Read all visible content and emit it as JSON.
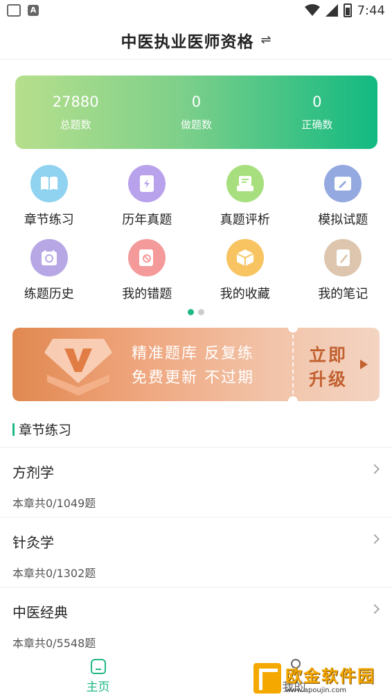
{
  "status_bar": {
    "time": "7:44"
  },
  "header": {
    "title": "中医执业医师资格",
    "switch_icon": "⇌"
  },
  "stats": [
    {
      "value": "27880",
      "label": "总题数"
    },
    {
      "value": "0",
      "label": "做题数"
    },
    {
      "value": "0",
      "label": "正确数"
    }
  ],
  "features": [
    {
      "label": "章节练习",
      "icon": "book-icon",
      "color": "#8fd3f0"
    },
    {
      "label": "历年真题",
      "icon": "document-icon",
      "color": "#b9a2ec"
    },
    {
      "label": "真题评析",
      "icon": "review-icon",
      "color": "#a8df7e"
    },
    {
      "label": "模拟试题",
      "icon": "exam-icon",
      "color": "#93a9df"
    },
    {
      "label": "练题历史",
      "icon": "history-icon",
      "color": "#b7a7e5"
    },
    {
      "label": "我的错题",
      "icon": "wrong-icon",
      "color": "#f49a9a"
    },
    {
      "label": "我的收藏",
      "icon": "box-icon",
      "color": "#f7c461"
    },
    {
      "label": "我的笔记",
      "icon": "note-icon",
      "color": "#ddc6ad"
    }
  ],
  "banner": {
    "line1": "精准题库 反复练",
    "line2": "免费更新 不过期",
    "cta_line1": "立即",
    "cta_line2": "升级"
  },
  "section": {
    "title": "章节练习"
  },
  "chapters": [
    {
      "name": "方剂学",
      "count": "本章共0/1049题"
    },
    {
      "name": "针灸学",
      "count": "本章共0/1302题"
    },
    {
      "name": "中医经典",
      "count": "本章共0/5548题"
    }
  ],
  "bottom_nav": {
    "home_label": "主页",
    "me_label": "我的"
  },
  "watermark": {
    "text": "欧金软件园",
    "url": "www.apoujin.com"
  },
  "colors": {
    "accent": "#1fb884",
    "banner_cta": "#c26030"
  }
}
